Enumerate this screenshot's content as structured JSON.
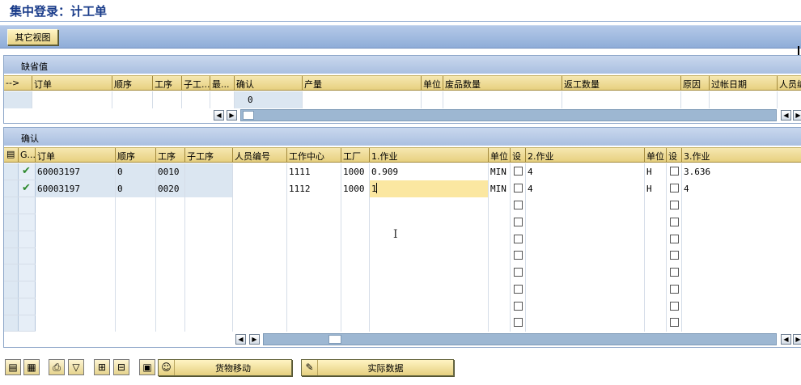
{
  "window": {
    "title": "集中登录：计工单"
  },
  "toolbar": {
    "other_view": "其它视图"
  },
  "defaults": {
    "title": "缺省值",
    "columns": [
      "-->",
      "订单",
      "顺序",
      "工序",
      "子工...",
      "最...",
      "确认",
      "产量",
      "单位",
      "废品数量",
      "返工数量",
      "原因",
      "过帐日期",
      "人员编"
    ],
    "row": {
      "confirm_value": "0"
    }
  },
  "confirm": {
    "title": "确认",
    "columns": {
      "g": "G...",
      "order": "订单",
      "seq": "顺序",
      "op": "工序",
      "subop": "子工序",
      "person": "人员编号",
      "wc": "工作中心",
      "plant": "工厂",
      "act1": "1.作业",
      "unit1": "单位",
      "set1": "设",
      "act2": "2.作业",
      "unit2": "单位",
      "set2": "设",
      "act3": "3.作业"
    },
    "rows": [
      {
        "status": "✔",
        "order": "60003197",
        "seq": "0",
        "op": "0010",
        "subop": "",
        "person": "",
        "wc": "1111",
        "plant": "1000",
        "act1": "0.909",
        "unit1": "MIN",
        "act2": "4",
        "unit2": "H",
        "act3": "3.636"
      },
      {
        "status": "✔",
        "order": "60003197",
        "seq": "0",
        "op": "0020",
        "subop": "",
        "person": "",
        "wc": "1112",
        "plant": "1000",
        "act1": "1",
        "unit1": "MIN",
        "act2": "4",
        "unit2": "H",
        "act3": "4"
      }
    ],
    "empty_rows": 8
  },
  "bottom": {
    "goods_movement": "货物移动",
    "actual_data": "实际数据"
  },
  "icons": [
    "select-all-icon",
    "deselect-all-icon",
    "print-icon",
    "filter-icon",
    "add-row-icon",
    "delete-row-icon",
    "details-icon",
    "person-icon",
    "goods-movement-icon",
    "actual-data-icon"
  ],
  "colors": {
    "header_bg": "#e7d080",
    "group_title_bg": "#aabfe0",
    "readonly_cell": "#dbe6f1",
    "focus_cell": "#fbe7a1",
    "check_green": "#2f8a2f"
  }
}
